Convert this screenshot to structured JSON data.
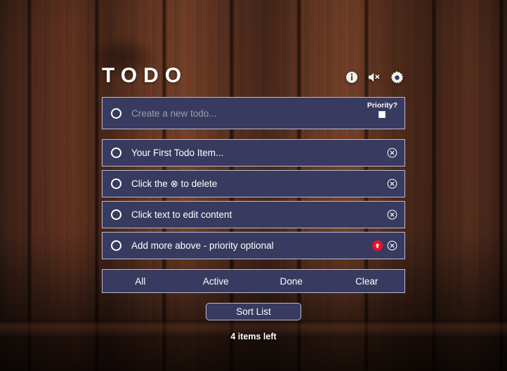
{
  "header": {
    "title": "TODO",
    "icons": [
      {
        "name": "info-icon",
        "label": "Info"
      },
      {
        "name": "mute-icon",
        "label": "Sound muted"
      },
      {
        "name": "gear-icon",
        "label": "Settings"
      }
    ]
  },
  "new_todo": {
    "placeholder": "Create a new todo...",
    "value": "",
    "priority_label": "Priority?",
    "priority_checked": false
  },
  "todos": [
    {
      "text": "Your First Todo Item...",
      "done": false,
      "priority": false
    },
    {
      "text": "Click the ⊗ to delete",
      "done": false,
      "priority": false
    },
    {
      "text": "Click text to edit content",
      "done": false,
      "priority": false
    },
    {
      "text": "Add more above - priority optional",
      "done": false,
      "priority": true
    }
  ],
  "filters": [
    {
      "label": "All"
    },
    {
      "label": "Active"
    },
    {
      "label": "Done"
    },
    {
      "label": "Clear"
    }
  ],
  "sort": {
    "label": "Sort List"
  },
  "status": {
    "items_left": "4 items left"
  },
  "colors": {
    "panel": "#383b5f",
    "panel_border": "#b9bcd0",
    "priority_badge": "#e8112d",
    "text": "#ffffff",
    "placeholder": "#9b9dad",
    "wood": "#4a2d1f"
  }
}
